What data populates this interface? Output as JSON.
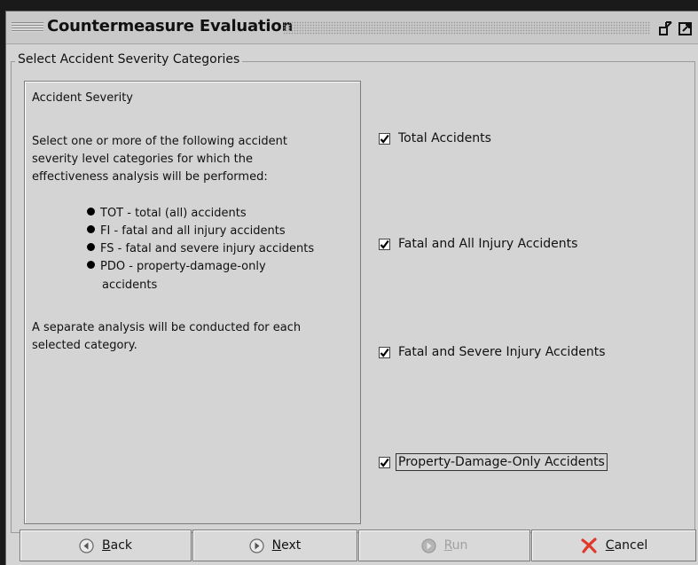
{
  "window": {
    "title": "Countermeasure Evaluation"
  },
  "group": {
    "label": "Select Accident Severity Categories"
  },
  "info": {
    "heading": "Accident Severity",
    "intro_lines": [
      "Select one or more of the following accident",
      "severity level categories for which the",
      "effectiveness analysis will be performed:"
    ],
    "bullets": [
      "TOT - total (all) accidents",
      "FI - fatal and all injury accidents",
      "FS - fatal and severe injury accidents",
      "PDO - property-damage-only"
    ],
    "bullet_continuation": "accidents",
    "outro_lines": [
      "A separate analysis will be conducted for each",
      "selected category."
    ]
  },
  "checkboxes": [
    {
      "label": "Total Accidents",
      "checked": true
    },
    {
      "label": "Fatal and All Injury Accidents",
      "checked": true
    },
    {
      "label": "Fatal and Severe Injury Accidents",
      "checked": true
    },
    {
      "label": "Property-Damage-Only Accidents",
      "checked": true,
      "focused": true
    }
  ],
  "buttons": {
    "back": {
      "mnemonic": "B",
      "rest": "ack",
      "icon": "back-arrow-icon"
    },
    "next": {
      "mnemonic": "N",
      "rest": "ext",
      "icon": "next-arrow-icon"
    },
    "run": {
      "mnemonic": "R",
      "rest": "un",
      "icon": "run-icon",
      "disabled": true
    },
    "cancel": {
      "mnemonic": "C",
      "rest": "ancel",
      "icon": "cancel-x-icon"
    }
  },
  "colors": {
    "background": "#d4d4d4",
    "cancel_icon": "#e0392b"
  }
}
